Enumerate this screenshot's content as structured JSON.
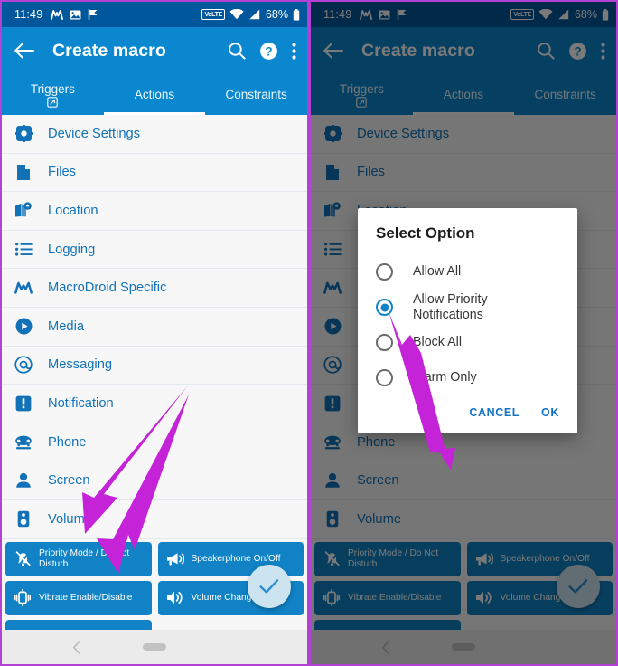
{
  "status_bar": {
    "time": "11:49",
    "left_icons": [
      "macrodroid-icon",
      "image-icon",
      "flag-icon"
    ],
    "network_badge": "VoLTE",
    "right_icons": [
      "wifi-icon",
      "signal-icon",
      "battery-icon"
    ],
    "battery": "68%"
  },
  "app_bar": {
    "title": "Create macro",
    "back_icon": "back-arrow-icon",
    "actions": [
      "search-icon",
      "help-icon",
      "overflow-menu-icon"
    ]
  },
  "tabs": [
    {
      "label": "Triggers",
      "active": false,
      "has_external_icon": true
    },
    {
      "label": "Actions",
      "active": true,
      "has_external_icon": false
    },
    {
      "label": "Constraints",
      "active": false,
      "has_external_icon": false
    }
  ],
  "list": [
    {
      "label": "Device Settings",
      "icon": "settings-gear-icon"
    },
    {
      "label": "Files",
      "icon": "file-document-icon"
    },
    {
      "label": "Location",
      "icon": "map-pin-icon"
    },
    {
      "label": "Logging",
      "icon": "list-lines-icon"
    },
    {
      "label": "MacroDroid Specific",
      "icon": "macrodroid-m-icon"
    },
    {
      "label": "Media",
      "icon": "play-circle-icon"
    },
    {
      "label": "Messaging",
      "icon": "at-sign-icon"
    },
    {
      "label": "Notification",
      "icon": "exclamation-square-icon"
    },
    {
      "label": "Phone",
      "icon": "telephone-icon"
    },
    {
      "label": "Screen",
      "icon": "person-icon"
    },
    {
      "label": "Volume",
      "icon": "speaker-device-icon"
    }
  ],
  "chips": [
    {
      "label": "Priority Mode / Do Not Disturb",
      "icon": "bell-off-icon"
    },
    {
      "label": "Speakerphone On/Off",
      "icon": "megaphone-icon"
    },
    {
      "label": "Vibrate Enable/Disable",
      "icon": "vibrate-icon"
    },
    {
      "label": "Volume Change",
      "icon": "volume-up-icon"
    }
  ],
  "fab": {
    "icon": "check-icon",
    "color": "#cbe4f0"
  },
  "nav_bar": {
    "back_icon": "nav-back-icon",
    "home_pill": "nav-home-pill"
  },
  "dialog": {
    "title": "Select Option",
    "options": [
      {
        "label": "Allow All",
        "selected": false
      },
      {
        "label": "Allow Priority Notifications",
        "selected": true
      },
      {
        "label": "Block All",
        "selected": false
      },
      {
        "label": "Alarm Only",
        "selected": false
      }
    ],
    "cancel_label": "CANCEL",
    "ok_label": "OK"
  },
  "annotations": {
    "arrow_color": "#c423d8",
    "left_panel_arrows": 2,
    "right_panel_arrows": 1
  },
  "colors": {
    "status_bar": "#01579b",
    "app_bar": "#0b87cf",
    "chip": "#1082c5",
    "list_text": "#1272b8",
    "frame_border": "#b342d4",
    "scrim": "rgba(0,0,0,0.52)"
  }
}
